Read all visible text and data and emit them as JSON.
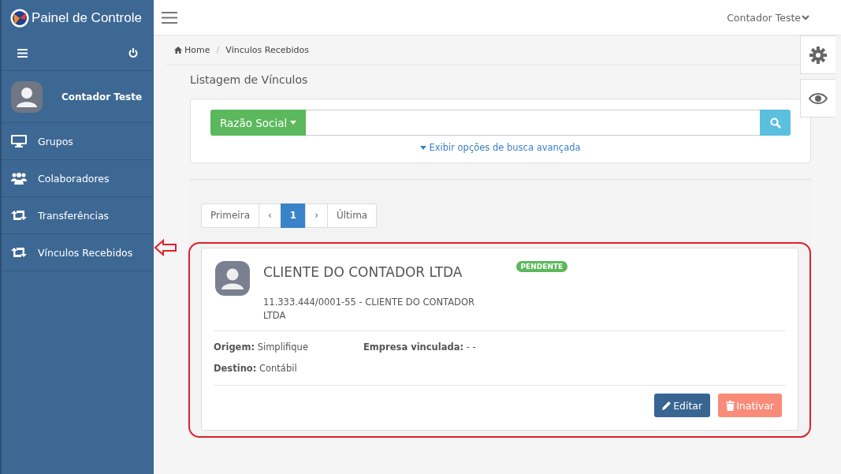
{
  "sidebar": {
    "brand": "Painel de Controle",
    "user": "Contador Teste",
    "items": [
      {
        "label": "Grupos",
        "kind": "monitor",
        "selected": false
      },
      {
        "label": "Colaboradores",
        "kind": "users",
        "selected": false
      },
      {
        "label": "Transferências",
        "kind": "transfer",
        "selected": false
      },
      {
        "label": "Vínculos Recebidos",
        "kind": "transfer",
        "selected": false
      }
    ]
  },
  "topbar": {
    "user": "Contador Teste"
  },
  "breadcrumb": {
    "separator": "/",
    "items": [
      "Home",
      "Vínculos Recebidos"
    ]
  },
  "page_title": "Listagem de Vínculos",
  "search": {
    "filter": "Razão Social",
    "advanced": "Exibir opções de busca avançada"
  },
  "pagination": [
    {
      "label": "Primeira",
      "selected": false
    },
    {
      "label": "‹",
      "selected": false
    },
    {
      "label": "1",
      "selected": true
    },
    {
      "label": "›",
      "selected": false
    },
    {
      "label": "Última",
      "selected": false
    }
  ],
  "card": {
    "name": "CLIENTE DO CONTADOR LTDA",
    "status": "PENDENTE",
    "subtitle": "11.333.444/0001-55 - CLIENTE DO CONTADOR LTDA",
    "fields": [
      "**Origem:** Simplifique",
      "**Empresa vinculada:** - -",
      "**Destino:** Contábil"
    ],
    "buttons": [
      {
        "label": "Editar",
        "kind": "edit"
      },
      {
        "label": "Inativar",
        "kind": "delete"
      }
    ]
  }
}
